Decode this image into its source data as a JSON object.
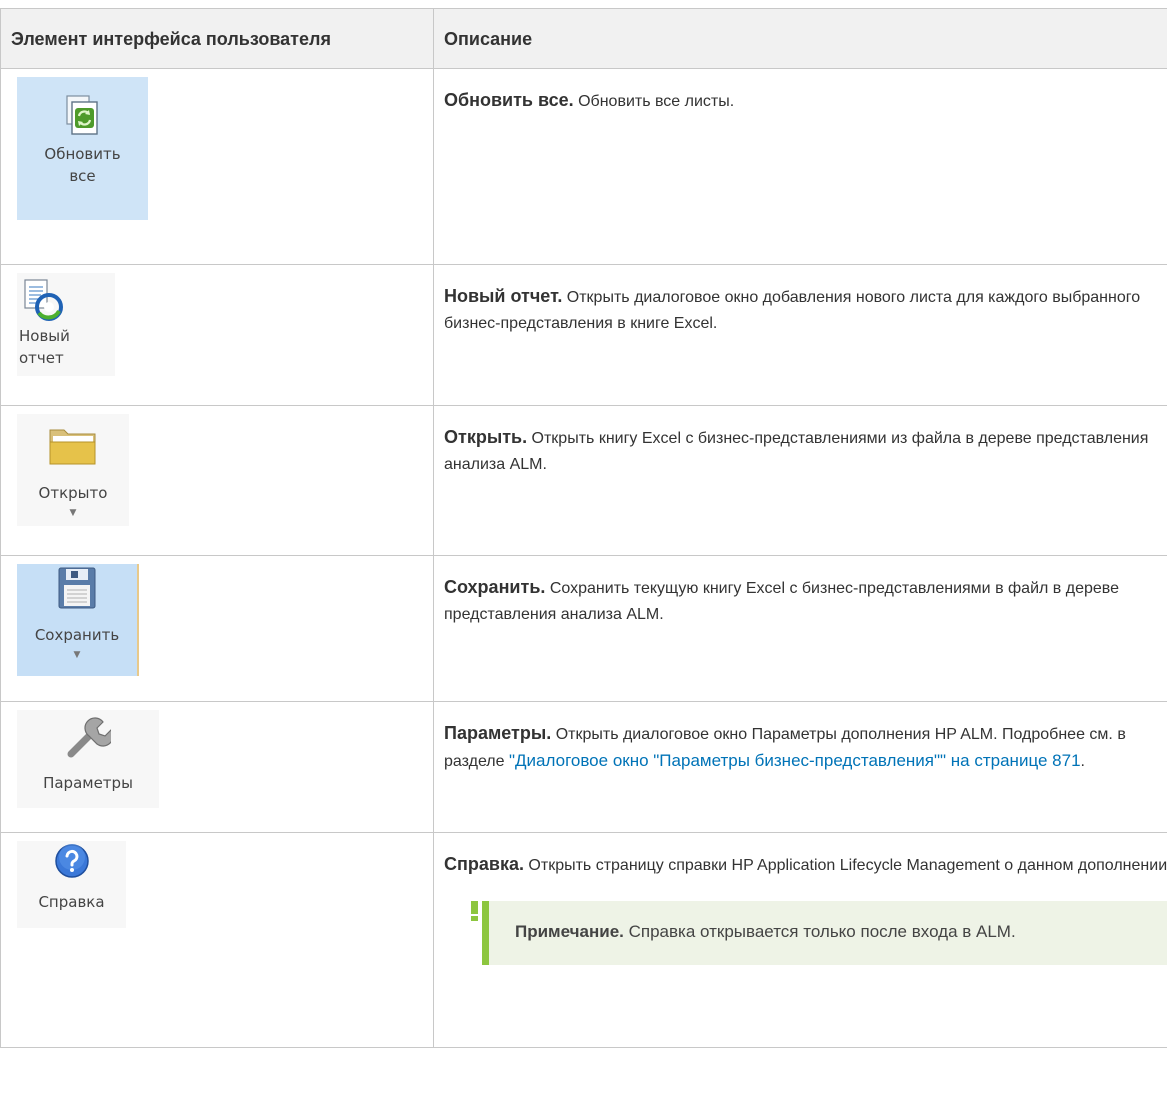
{
  "table": {
    "headers": {
      "element": "Элемент интерфейса пользователя",
      "description": "Описание"
    },
    "rows": [
      {
        "icon": "refresh-all-icon",
        "button_label": "Обновить все",
        "title": "Обновить все.",
        "text": "Обновить все листы."
      },
      {
        "icon": "new-report-icon",
        "button_label": "Новый отчет",
        "title": "Новый отчет.",
        "text": "Открыть диалоговое окно добавления нового листа для каждого выбранного бизнес-представления в книге Excel."
      },
      {
        "icon": "folder-icon",
        "button_label": "Открыто",
        "title": "Открыть.",
        "text": "Открыть книгу Excel с бизнес-представлениями из файла в дереве представления анализа ALM."
      },
      {
        "icon": "floppy-disk-icon",
        "button_label": "Сохранить",
        "title": "Сохранить.",
        "text": "Сохранить текущую книгу Excel с бизнес-представлениями в файл в дереве представления анализа ALM."
      },
      {
        "icon": "wrench-icon",
        "button_label": "Параметры",
        "title": "Параметры.",
        "text": "Открыть диалоговое окно Параметры дополнения HP ALM. Подробнее см. в разделе",
        "link": "\"Диалоговое окно \"Параметры бизнес-представления\"\" на странице 871",
        "after_link": "."
      },
      {
        "icon": "help-icon",
        "button_label": "Справка",
        "title": "Справка.",
        "text": "Открыть страницу справки HP Application Lifecycle Management о данном дополнении.",
        "note_title": "Примечание.",
        "note_text": "Справка открывается только после входа в ALM."
      }
    ]
  },
  "colors": {
    "header_bg": "#f1f1f1",
    "border": "#c8c8c8",
    "link": "#0073b7",
    "note_bg": "#eef3e6",
    "note_accent": "#8dc63f"
  }
}
